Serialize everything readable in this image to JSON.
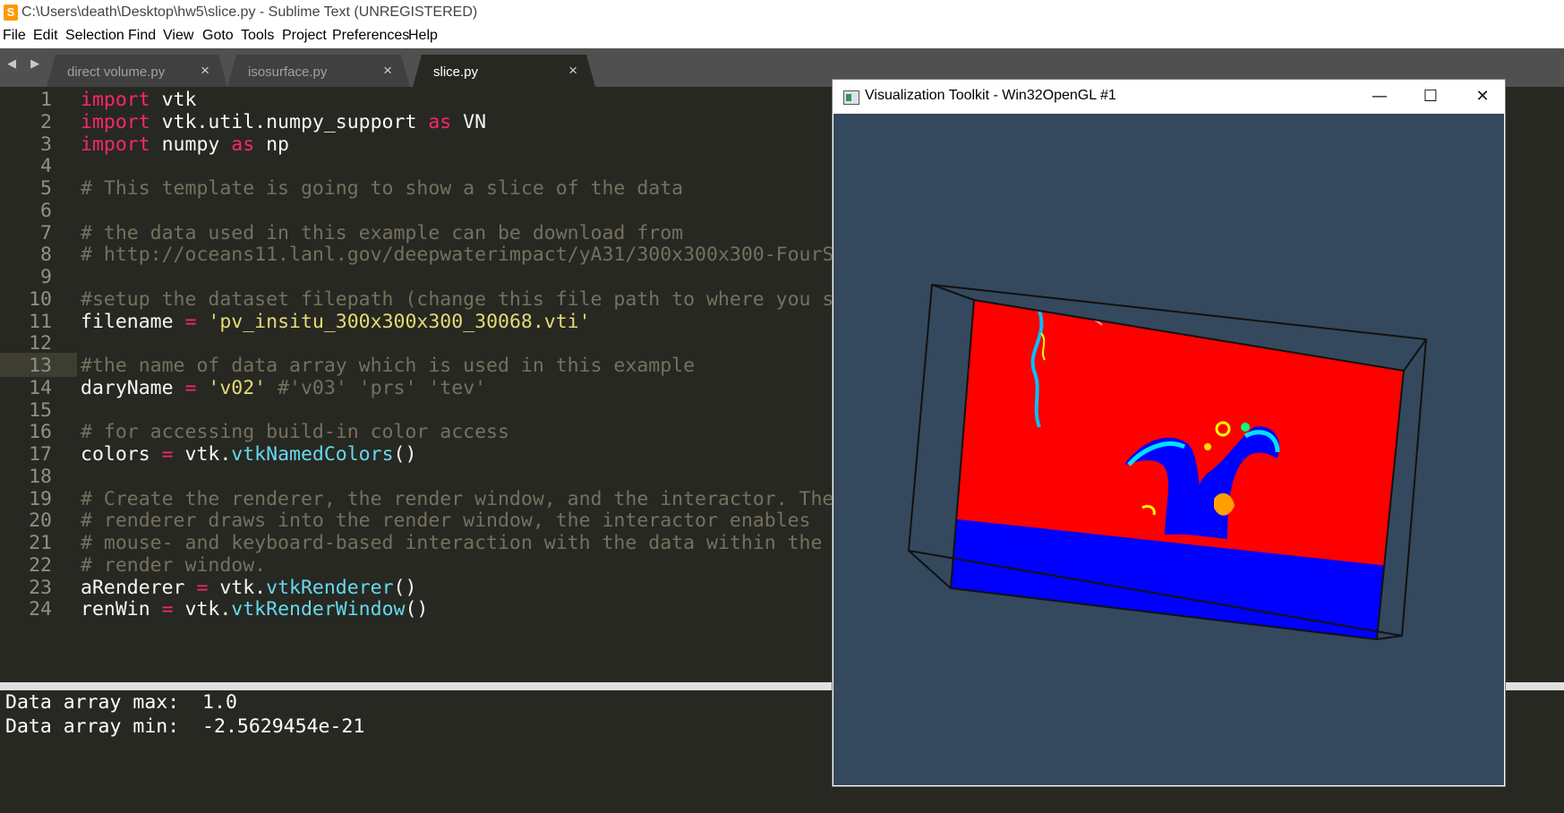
{
  "titlebar": {
    "icon": "sublime-text-icon",
    "icon_glyph": "S",
    "title": "C:\\Users\\death\\Desktop\\hw5\\slice.py - Sublime Text (UNREGISTERED)"
  },
  "menu": [
    "File",
    "Edit",
    "Selection",
    "Find",
    "View",
    "Goto",
    "Tools",
    "Project",
    "Preferences",
    "Help"
  ],
  "tabs": [
    {
      "label": "direct volume.py",
      "close": "×",
      "active": false
    },
    {
      "label": "isosurface.py",
      "close": "×",
      "active": false
    },
    {
      "label": "slice.py",
      "close": "×",
      "active": true
    }
  ],
  "nav_arrows": "◀ ▶",
  "editor": {
    "current_line": 13,
    "lines": [
      [
        [
          "kw",
          "import"
        ],
        [
          "pl",
          " vtk"
        ]
      ],
      [
        [
          "kw",
          "import"
        ],
        [
          "pl",
          " vtk.util.numpy_support "
        ],
        [
          "kw",
          "as"
        ],
        [
          "pl",
          " VN"
        ]
      ],
      [
        [
          "kw",
          "import"
        ],
        [
          "pl",
          " numpy "
        ],
        [
          "kw",
          "as"
        ],
        [
          "pl",
          " np"
        ]
      ],
      [],
      [
        [
          "cm",
          "# This template is going to show a slice of the data"
        ]
      ],
      [],
      [
        [
          "cm",
          "# the data used in this example can be download from"
        ]
      ],
      [
        [
          "cm",
          "# http://oceans11.lanl.gov/deepwaterimpact/yA31/300x300x300-FourS"
        ]
      ],
      [],
      [
        [
          "cm",
          "#setup the dataset filepath (change this file path to where you s"
        ]
      ],
      [
        [
          "pl",
          "filename "
        ],
        [
          "kw",
          "="
        ],
        [
          "pl",
          " "
        ],
        [
          "str",
          "'pv_insitu_300x300x300_30068.vti'"
        ]
      ],
      [],
      [
        [
          "cm",
          "#the name of data array which is used in this example"
        ]
      ],
      [
        [
          "pl",
          "daryName "
        ],
        [
          "kw",
          "="
        ],
        [
          "pl",
          " "
        ],
        [
          "str",
          "'v02'"
        ],
        [
          "pl",
          " "
        ],
        [
          "cm",
          "#'v03' 'prs' 'tev'"
        ]
      ],
      [],
      [
        [
          "cm",
          "# for accessing build-in color access"
        ]
      ],
      [
        [
          "pl",
          "colors "
        ],
        [
          "kw",
          "="
        ],
        [
          "pl",
          " vtk."
        ],
        [
          "fn",
          "vtkNamedColors"
        ],
        [
          "pl",
          "()"
        ]
      ],
      [],
      [
        [
          "cm",
          "# Create the renderer, the render window, and the interactor. The"
        ]
      ],
      [
        [
          "cm",
          "# renderer draws into the render window, the interactor enables"
        ]
      ],
      [
        [
          "cm",
          "# mouse- and keyboard-based interaction with the data within the"
        ]
      ],
      [
        [
          "cm",
          "# render window."
        ]
      ],
      [
        [
          "pl",
          "aRenderer "
        ],
        [
          "kw",
          "="
        ],
        [
          "pl",
          " vtk."
        ],
        [
          "fn",
          "vtkRenderer"
        ],
        [
          "pl",
          "()"
        ]
      ],
      [
        [
          "pl",
          "renWin "
        ],
        [
          "kw",
          "="
        ],
        [
          "pl",
          " vtk."
        ],
        [
          "fn",
          "vtkRenderWindow"
        ],
        [
          "pl",
          "()"
        ]
      ]
    ]
  },
  "console": [
    "Data array max:  1.0",
    "Data array min:  -2.5629454e-21"
  ],
  "vtk_window": {
    "title": "Visualization Toolkit - Win32OpenGL #1",
    "minimize": "—",
    "maximize": "☐",
    "close": "✕",
    "background": "#34495e"
  },
  "colors": {
    "keyword": "#f92672",
    "string": "#e6db74",
    "comment": "#75715e",
    "function": "#66d9ef",
    "editor_bg": "#272822",
    "slice_red": "#ff0000",
    "slice_blue": "#0000ff"
  }
}
